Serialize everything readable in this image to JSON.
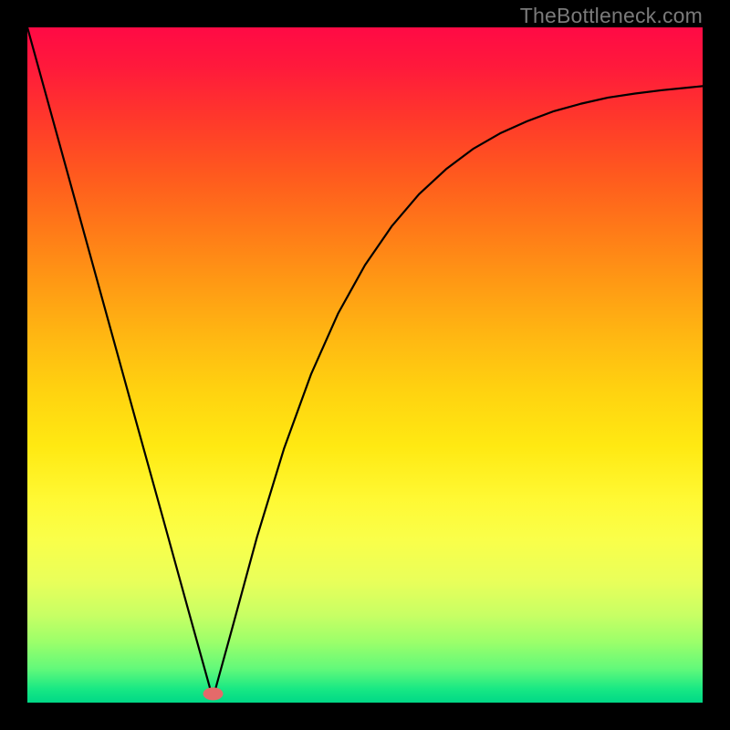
{
  "watermark": "TheBottleneck.com",
  "marker": {
    "color": "#e46a6a",
    "cx_frac": 0.275,
    "cy_frac": 0.987,
    "rx": 11,
    "ry": 7
  },
  "chart_data": {
    "type": "line",
    "title": "",
    "xlabel": "",
    "ylabel": "",
    "xlim": [
      0,
      1
    ],
    "ylim": [
      0,
      1
    ],
    "grid": false,
    "legend": false,
    "series": [
      {
        "name": "curve",
        "x": [
          0.0,
          0.04,
          0.08,
          0.12,
          0.16,
          0.2,
          0.24,
          0.27,
          0.273,
          0.276,
          0.3,
          0.34,
          0.38,
          0.42,
          0.46,
          0.5,
          0.54,
          0.58,
          0.62,
          0.66,
          0.7,
          0.74,
          0.78,
          0.82,
          0.86,
          0.9,
          0.94,
          0.98,
          1.0
        ],
        "y": [
          1.0,
          0.855,
          0.71,
          0.565,
          0.42,
          0.276,
          0.131,
          0.023,
          0.012,
          0.011,
          0.098,
          0.245,
          0.376,
          0.486,
          0.576,
          0.648,
          0.706,
          0.753,
          0.79,
          0.82,
          0.843,
          0.861,
          0.876,
          0.887,
          0.896,
          0.902,
          0.907,
          0.911,
          0.913
        ]
      }
    ]
  }
}
